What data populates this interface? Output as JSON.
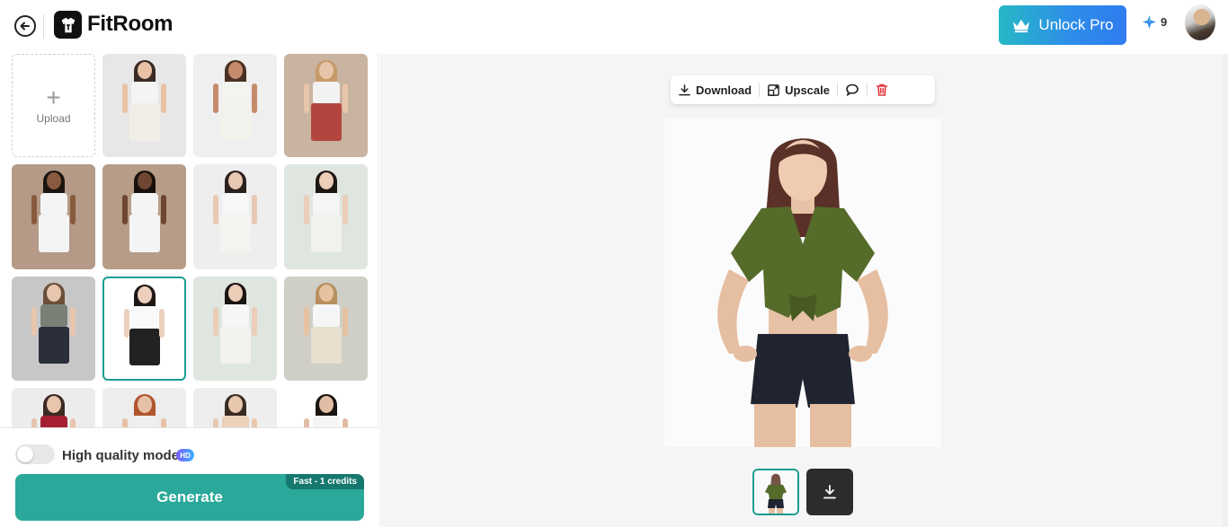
{
  "header": {
    "logo_text": "FitRoom",
    "unlock_label": "Unlock Pro",
    "credits": "9"
  },
  "left": {
    "upload_label": "Upload",
    "hq_label": "High quality mode",
    "hq_badge": "HD",
    "generate_label": "Generate",
    "generate_badge": "Fast - 1 credits",
    "models": [
      {
        "bg": "#e7e7e7",
        "skin": "#e9c2a6",
        "hair": "#3a2b25",
        "top": "#f4f4f4",
        "bottom": "#f1eee8",
        "selected": false
      },
      {
        "bg": "#efefef",
        "skin": "#c48a6c",
        "hair": "#4a3124",
        "top": "#f3f3f0",
        "bottom": "#f2f1ec",
        "selected": false
      },
      {
        "bg": "#c9b3a1",
        "skin": "#e8c5aa",
        "hair": "#c79a6a",
        "top": "#f2f2f2",
        "bottom": "#b4453e",
        "selected": false
      },
      {
        "bg": "#b49a87",
        "skin": "#8a5a3f",
        "hair": "#1c1410",
        "top": "#f4f4f4",
        "bottom": "#f4f4f4",
        "selected": false
      },
      {
        "bg": "#b79d88",
        "skin": "#6e4632",
        "hair": "#17110d",
        "top": "#f4f4f4",
        "bottom": "#f4f4f4",
        "selected": false
      },
      {
        "bg": "#eeeeee",
        "skin": "#e8c8b2",
        "hair": "#2a211d",
        "top": "#f7f7f7",
        "bottom": "#f4f3ef",
        "selected": false
      },
      {
        "bg": "#dfe5df",
        "skin": "#ebcdb8",
        "hair": "#1d1714",
        "top": "#f5f5f5",
        "bottom": "#f1f1ee",
        "selected": false
      },
      {
        "bg": "#c7c7c7",
        "skin": "#e8c6ad",
        "hair": "#6b4f3a",
        "top": "#7b8077",
        "bottom": "#2b2f3b",
        "selected": false
      },
      {
        "bg": "#ffffff",
        "skin": "#ecd0bd",
        "hair": "#1e1815",
        "top": "#f9f9f9",
        "bottom": "#222222",
        "selected": true
      },
      {
        "bg": "#dfe5df",
        "skin": "#ebcdb8",
        "hair": "#1b1512",
        "top": "#f6f6f6",
        "bottom": "#f2f2ee",
        "selected": false
      },
      {
        "bg": "#cfcfc8",
        "skin": "#e6c2a1",
        "hair": "#b8905f",
        "top": "#f6f6f6",
        "bottom": "#e8dfcf",
        "selected": false
      },
      {
        "bg": "#ececec",
        "skin": "#e8c5ac",
        "hair": "#3b2a22",
        "top": "#a51f32",
        "bottom": "#eeeeee",
        "selected": false
      },
      {
        "bg": "#ededed",
        "skin": "#e6c1a7",
        "hair": "#b1552f",
        "top": "#eeeeee",
        "bottom": "#eeeeee",
        "selected": false
      },
      {
        "bg": "#eeeeee",
        "skin": "#e8c8ad",
        "hair": "#3a2c24",
        "top": "#e9d2b7",
        "bottom": "#eeeeee",
        "selected": false
      },
      {
        "bg": "#ffffff",
        "skin": "#e2bda5",
        "hair": "#1a1411",
        "top": "#f4f4f4",
        "bottom": "#f4f4f4",
        "selected": false
      }
    ]
  },
  "canvas": {
    "download_label": "Download",
    "upscale_label": "Upscale"
  },
  "colors": {
    "accent": "#2aa89a",
    "delete": "#e0393e",
    "shirt": "#556b2a",
    "shorts": "#1f2430"
  }
}
